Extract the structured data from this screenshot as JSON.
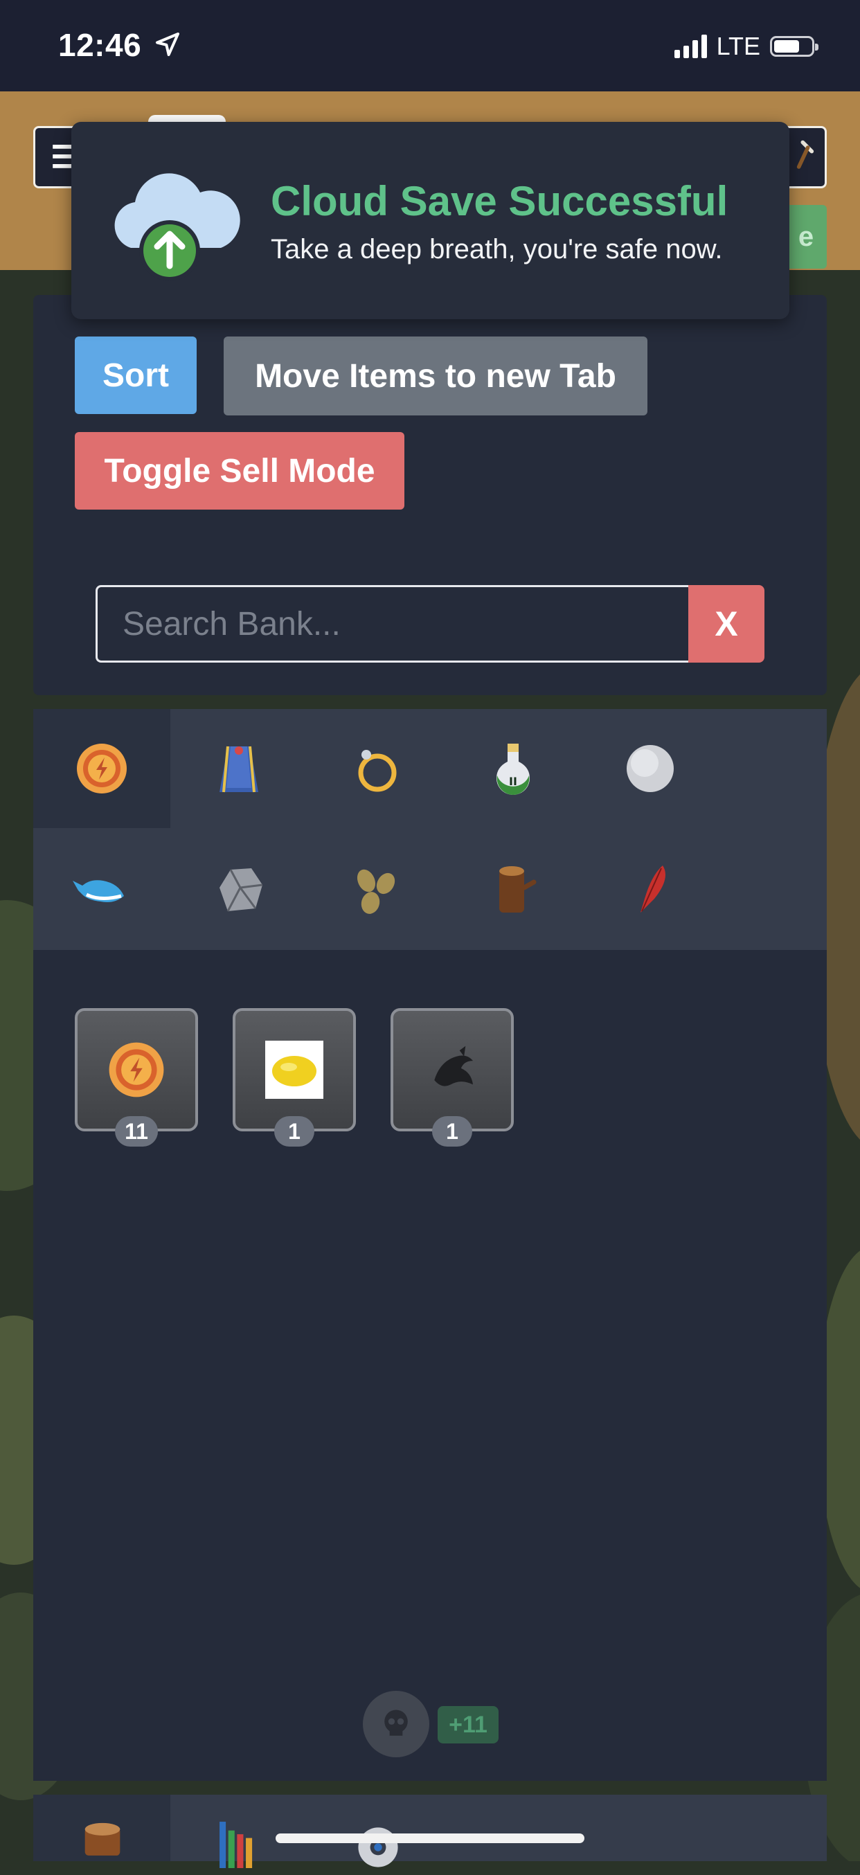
{
  "status_bar": {
    "time": "12:46",
    "network": "LTE",
    "battery_fraction": 0.6,
    "signal_bars": 4
  },
  "header": {
    "menu_glyph": "☰",
    "green_button_fragment": "e"
  },
  "toast": {
    "title": "Cloud Save Successful",
    "message": "Take a deep breath, you're safe now.",
    "icon": "cloud-upload-icon"
  },
  "bank_controls": {
    "sort_label": "Sort",
    "move_label": "Move Items to new Tab",
    "sell_mode_label": "Toggle Sell Mode"
  },
  "search": {
    "placeholder": "Search Bank...",
    "value": "",
    "clear_label": "X"
  },
  "tabs": [
    {
      "icon": "coin-icon",
      "active": true
    },
    {
      "icon": "cape-icon",
      "active": false
    },
    {
      "icon": "ring-icon",
      "active": false
    },
    {
      "icon": "potion-icon",
      "active": false
    },
    {
      "icon": "orb-icon",
      "active": false
    },
    {
      "icon": "whale-icon",
      "active": false
    },
    {
      "icon": "rock-icon",
      "active": false
    },
    {
      "icon": "seeds-icon",
      "active": false
    },
    {
      "icon": "log-icon",
      "active": false
    },
    {
      "icon": "feather-icon",
      "active": false
    }
  ],
  "items": [
    {
      "icon": "coin-icon",
      "quantity": "11"
    },
    {
      "icon": "lemon-icon",
      "quantity": "1"
    },
    {
      "icon": "fish-icon",
      "quantity": "1"
    }
  ],
  "footer": {
    "skull_icon": "skull-icon",
    "bonus_label": "+11"
  },
  "colors": {
    "accent_blue": "#5fa8e6",
    "danger_red": "#df6f6f",
    "success_green": "#5fc28a",
    "panel": "#252b3a",
    "header_tan": "#b0854a"
  }
}
